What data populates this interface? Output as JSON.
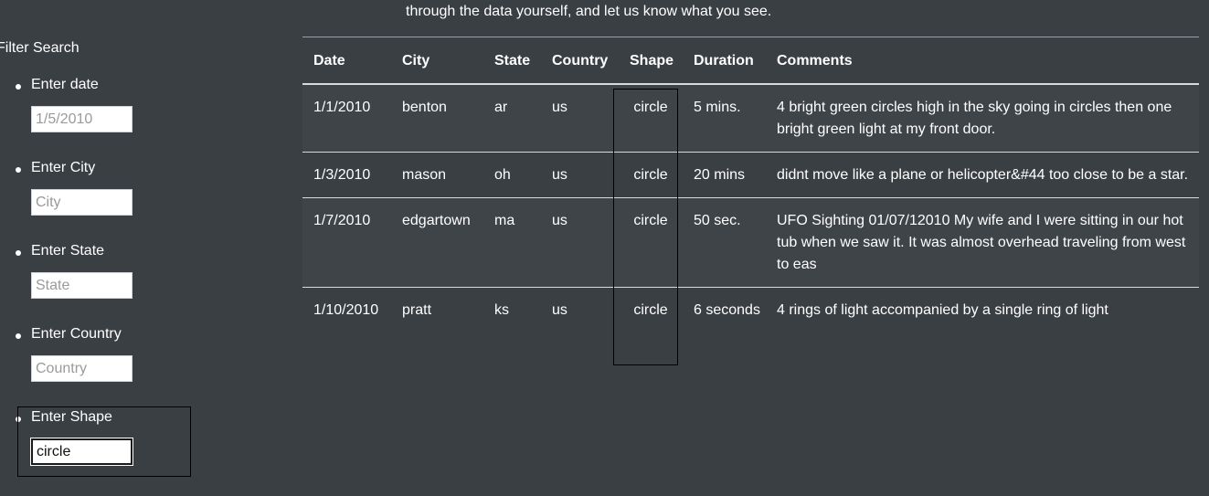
{
  "intro_text": "through the data yourself, and let us know what you see.",
  "filters": {
    "heading": "Filter Search",
    "items": [
      {
        "label": "Enter date",
        "placeholder": "1/5/2010",
        "value": ""
      },
      {
        "label": "Enter City",
        "placeholder": "City",
        "value": ""
      },
      {
        "label": "Enter State",
        "placeholder": "State",
        "value": ""
      },
      {
        "label": "Enter Country",
        "placeholder": "Country",
        "value": ""
      },
      {
        "label": "Enter Shape",
        "placeholder": "",
        "value": "circle"
      }
    ]
  },
  "table": {
    "headers": [
      "Date",
      "City",
      "State",
      "Country",
      "Shape",
      "Duration",
      "Comments"
    ],
    "rows": [
      [
        "1/1/2010",
        "benton",
        "ar",
        "us",
        "circle",
        "5 mins.",
        "4 bright green circles high in the sky going in circles then one bright green light at my front door."
      ],
      [
        "1/3/2010",
        "mason",
        "oh",
        "us",
        "circle",
        "20 mins",
        "didnt move like a plane or helicopter&#44 too close to be a star."
      ],
      [
        "1/7/2010",
        "edgartown",
        "ma",
        "us",
        "circle",
        "50 sec.",
        "UFO Sighting 01/07/12010 My wife and I were sitting in our hot tub when we saw it. It was almost overhead traveling from west to eas"
      ],
      [
        "1/10/2010",
        "pratt",
        "ks",
        "us",
        "circle",
        "6 seconds",
        "4 rings of light accompanied by a single ring of light"
      ]
    ]
  }
}
